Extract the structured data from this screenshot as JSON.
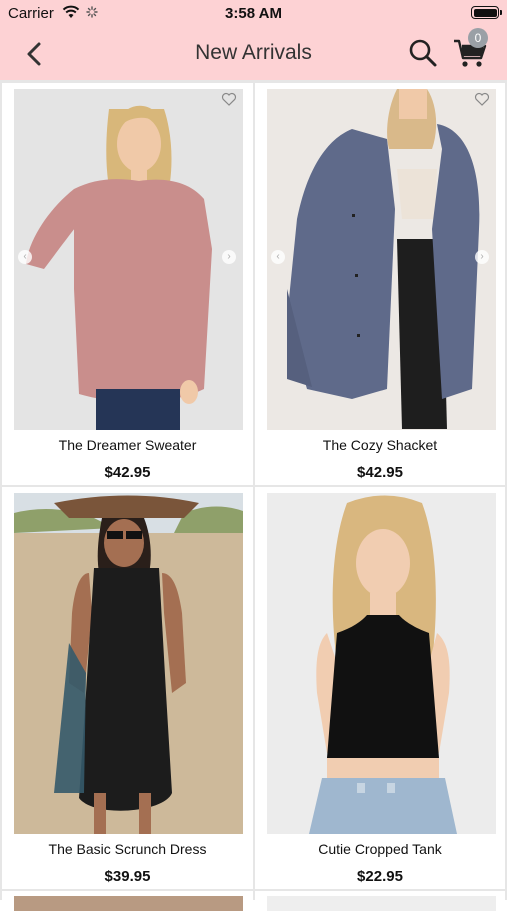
{
  "status_bar": {
    "carrier": "Carrier",
    "time": "3:58 AM"
  },
  "nav": {
    "title": "New Arrivals",
    "cart_count": "0"
  },
  "icons": {
    "back": "chevron-left-icon",
    "search": "search-icon",
    "cart": "cart-icon",
    "favorite": "heart-icon"
  },
  "colors": {
    "header_bg": "#fdd2d4",
    "badge": "#9aa0a6"
  },
  "products": [
    {
      "name": "The Dreamer Sweater",
      "price": "$42.95"
    },
    {
      "name": "The Cozy Shacket",
      "price": "$42.95"
    },
    {
      "name": "The Basic Scrunch Dress",
      "price": "$39.95"
    },
    {
      "name": "Cutie Cropped Tank",
      "price": "$22.95"
    }
  ]
}
